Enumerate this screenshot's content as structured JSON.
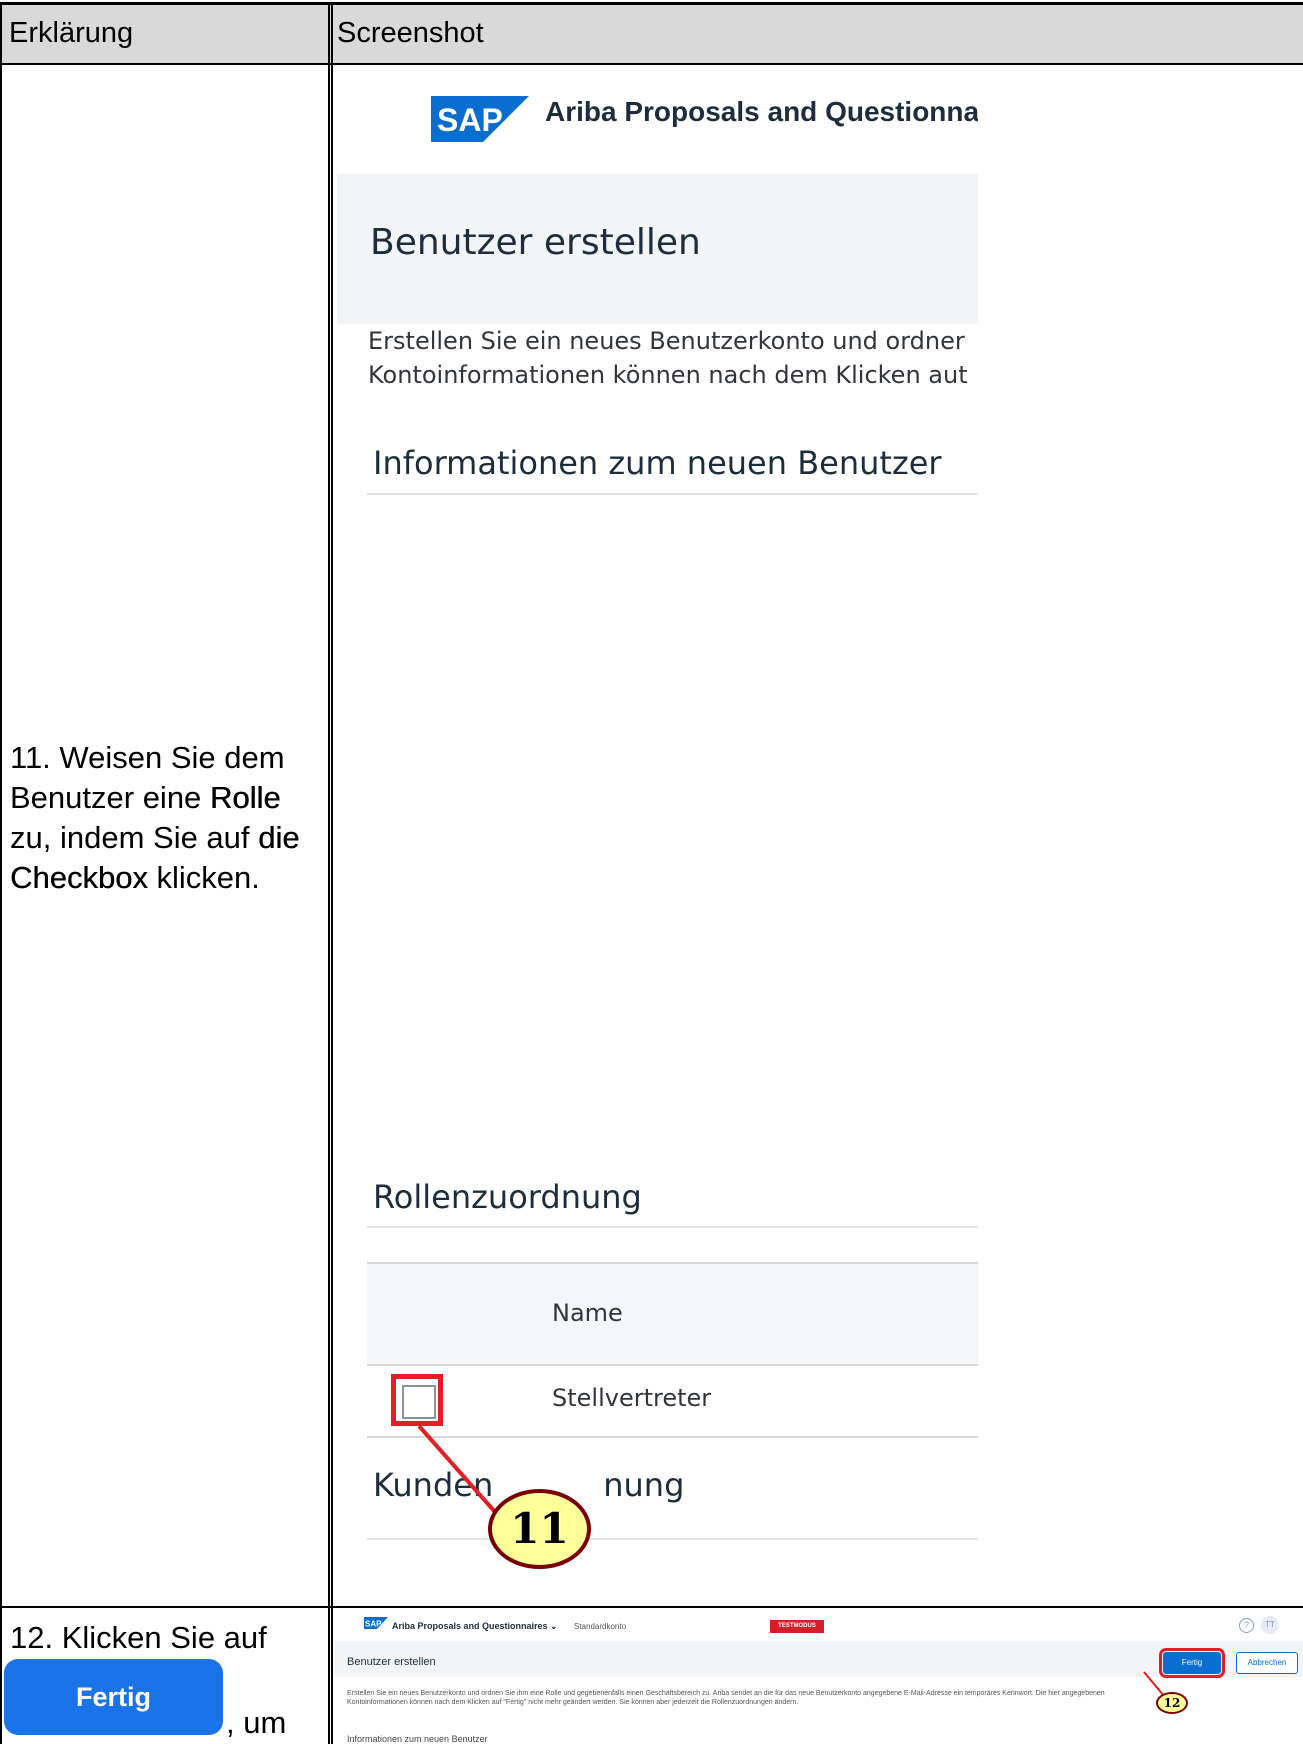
{
  "table": {
    "header_left": "Erklärung",
    "header_right": "Screenshot"
  },
  "step11": {
    "text_part1": "11. Weisen Sie dem Benutzer eine ",
    "rolle": "Rolle",
    "text_part2": " zu, indem Sie auf ",
    "die": "die",
    "checkbox": "Checkbox",
    "text_part3": "  klicken.",
    "callout": "11",
    "screenshot": {
      "logo_text": "SAP",
      "app_title": "Ariba Proposals and Questionnai",
      "page_title": "Benutzer erstellen",
      "desc_line1": "Erstellen Sie ein neues Benutzerkonto und ordner",
      "desc_line2": "Kontoinformationen können nach dem Klicken aut",
      "section_info": "Informationen zum neuen Benutzer",
      "section_roles": "Rollenzuordnung",
      "col_name": "Name",
      "role_name": "Stellvertreter",
      "section_kunden_a": "Kunden",
      "section_kunden_b": "nung"
    }
  },
  "step12": {
    "text_before": "12. Klicken Sie auf",
    "button_label": "Fertig",
    "text_after": ", um",
    "callout": "12",
    "screenshot": {
      "logo_text": "SAP",
      "app_title": "Ariba Proposals and Questionnaires ⌄",
      "account": "Standardkonto",
      "test_badge": "TESTMODUS",
      "help": "?",
      "avatar": "TT",
      "page_title": "Benutzer erstellen",
      "fertig": "Fertig",
      "abbrechen": "Abbrechen",
      "desc_line1": "Erstellen Sie ein neues Benutzerkonto und ordnen Sie ihm eine Rolle und gegebenenfalls einen Geschäftsbereich zu. Ariba sendet an die für das neue Benutzerkonto angegebene E-Mail-Adresse ein temporäres Kennwort. Die hier angegebenen",
      "desc_line2": "Kontoinformationen können nach dem Klicken auf \"Fertig\" nicht mehr geändert werden. Sie können aber jederzeit die Rollenzuordnungen ändern.",
      "section_info": "Informationen zum neuen Benutzer"
    }
  },
  "colors": {
    "sap_blue": "#0a6ed1",
    "highlight_red": "#e31e24",
    "callout_fill": "#ffff99",
    "header_gray": "#d9d9d9"
  }
}
